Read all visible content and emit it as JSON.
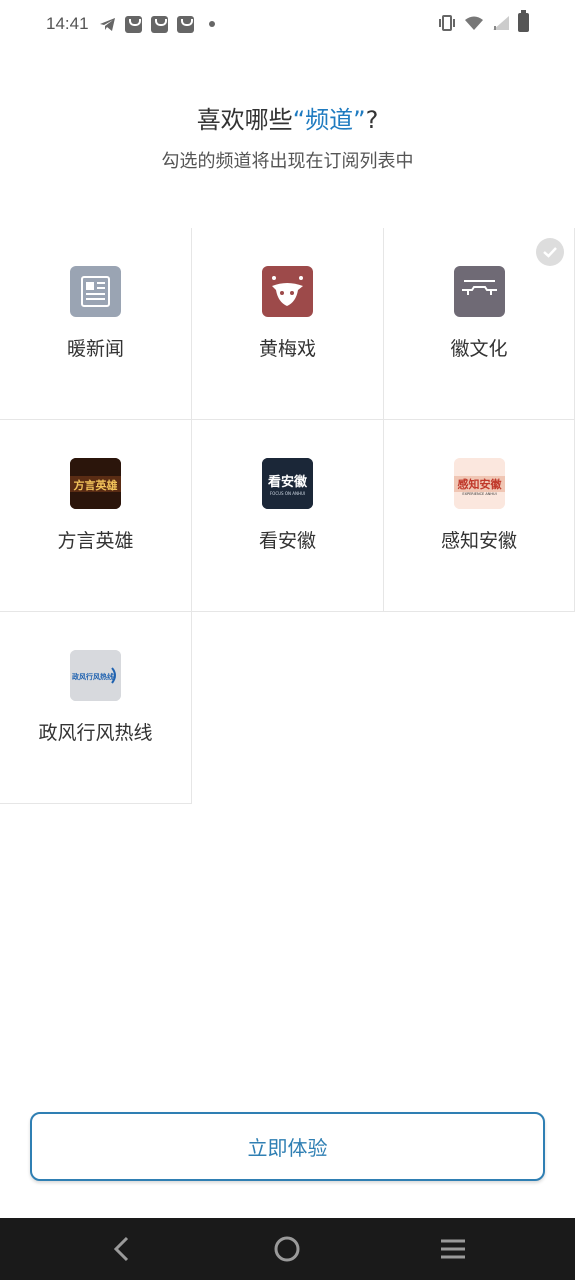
{
  "status_bar": {
    "time": "14:41",
    "left_icons": [
      "telegram-icon",
      "shopping-bag-icon",
      "shopping-bag-icon",
      "shopping-bag-icon",
      "dot-icon"
    ],
    "right_icons": [
      "vibrate-icon",
      "wifi-icon",
      "signal-icon",
      "battery-icon"
    ]
  },
  "header": {
    "title_prefix": "喜欢哪些",
    "title_accent": "“频道”",
    "title_suffix": "?",
    "subtitle": "勾选的频道将出现在订阅列表中"
  },
  "channels": [
    {
      "label": "暖新闻",
      "icon": "newspaper-icon",
      "color": "#9aa4b3",
      "selected": false
    },
    {
      "label": "黄梅戏",
      "icon": "opera-mask-icon",
      "color": "#9d4a4a",
      "selected": false
    },
    {
      "label": "徽文化",
      "icon": "architecture-icon",
      "color": "#6f6a75",
      "selected": true
    },
    {
      "label": "方言英雄",
      "icon": "dialect-hero-logo",
      "logo_text": "方言英雄",
      "color": "#3a1e10",
      "selected": false
    },
    {
      "label": "看安徽",
      "icon": "kan-anhui-logo",
      "logo_text": "看安徽",
      "logo_subtext": "FOCUS ON ANHUI",
      "color": "#1b2738",
      "selected": false
    },
    {
      "label": "感知安徽",
      "icon": "ganzhi-anhui-logo",
      "logo_text": "感知安徽",
      "logo_subtext": "EXPERIENCE ANHUI",
      "color": "#f1c9b9",
      "selected": false
    },
    {
      "label": "政风行风热线",
      "icon": "hotline-logo",
      "logo_text": "政风行风热线",
      "color": "#d7d9dd",
      "selected": false
    }
  ],
  "cta": {
    "label": "立即体验"
  },
  "navbar": {
    "buttons": [
      "back-icon",
      "home-icon",
      "menu-icon"
    ]
  },
  "colors": {
    "accent": "#1f7bc0",
    "button_border": "#2f7fb3"
  }
}
